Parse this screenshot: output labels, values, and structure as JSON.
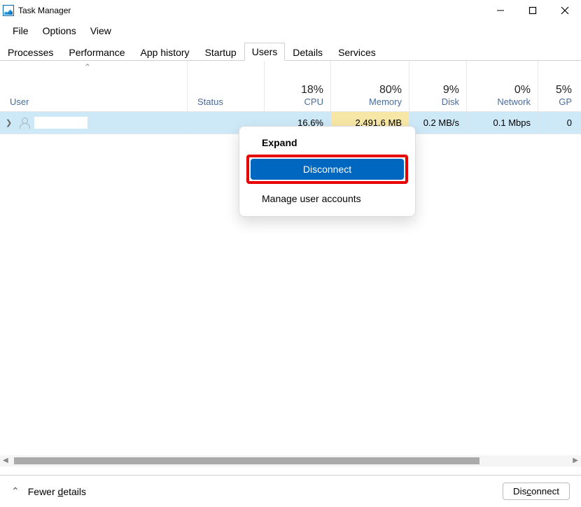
{
  "title": "Task Manager",
  "menu": {
    "file": "File",
    "options": "Options",
    "view": "View"
  },
  "tabs": {
    "processes": "Processes",
    "performance": "Performance",
    "app_history": "App history",
    "startup": "Startup",
    "users": "Users",
    "details": "Details",
    "services": "Services"
  },
  "columns": {
    "user": "User",
    "status": "Status",
    "cpu": "CPU",
    "memory": "Memory",
    "disk": "Disk",
    "network": "Network",
    "gpu": "GP"
  },
  "totals": {
    "cpu": "18%",
    "memory": "80%",
    "disk": "9%",
    "network": "0%",
    "gpu": "5%"
  },
  "row": {
    "cpu": "16.6%",
    "memory": "2,491.6 MB",
    "disk": "0.2 MB/s",
    "network": "0.1 Mbps",
    "gpu": "0"
  },
  "context_menu": {
    "expand": "Expand",
    "disconnect": "Disconnect",
    "manage": "Manage user accounts"
  },
  "footer": {
    "fewer": "Fewer details",
    "disconnect_btn": "Disconnect"
  },
  "underline": {
    "fewer": "d",
    "disconnect": "c"
  }
}
